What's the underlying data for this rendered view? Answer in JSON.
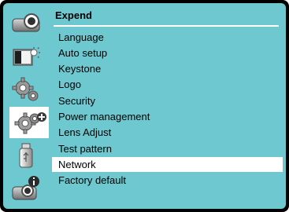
{
  "panel": {
    "title": "Expend"
  },
  "menu": {
    "items": [
      {
        "label": "Language"
      },
      {
        "label": "Auto setup"
      },
      {
        "label": "Keystone"
      },
      {
        "label": "Logo"
      },
      {
        "label": "Security"
      },
      {
        "label": "Power management"
      },
      {
        "label": "Lens Adjust"
      },
      {
        "label": "Test pattern"
      },
      {
        "label": "Network"
      },
      {
        "label": "Factory default"
      }
    ],
    "highlighted": "Network"
  },
  "sidebar": {
    "icons": [
      "projector-input-icon",
      "display-setting-icon",
      "gear-setting-icon",
      "expand-gear-plus-icon",
      "usb-memory-icon",
      "projector-info-icon"
    ],
    "selected": "expand-gear-plus-icon"
  },
  "colors": {
    "background": "#6ec8d0",
    "frame": "#000000",
    "highlight": "#ffffff"
  }
}
